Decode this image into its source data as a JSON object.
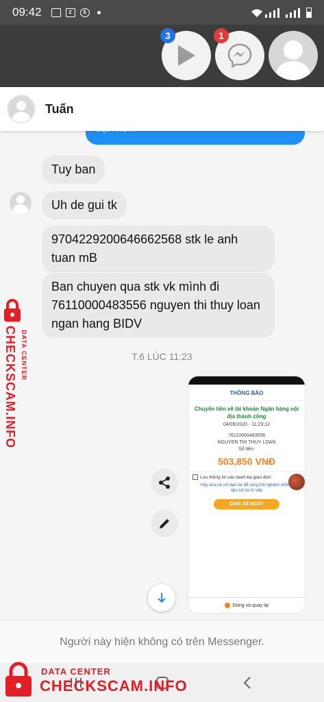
{
  "status_bar": {
    "time": "09:42",
    "icons": [
      "image-icon",
      "zalo-icon",
      "sync-icon",
      "wifi-icon",
      "signal-icon",
      "signal-icon",
      "battery-icon"
    ]
  },
  "chat_heads": [
    {
      "name": "video-player",
      "badge": "3"
    },
    {
      "name": "messenger",
      "badge": "1"
    },
    {
      "name": "contact-avatar",
      "badge": ""
    }
  ],
  "header": {
    "contact_name": "Tuấn"
  },
  "messages": {
    "sent_partial": "bạn liền.",
    "received": [
      "Tuy ban",
      "Uh de gui tk",
      "9704229200646662568 stk le anh tuan mB",
      "Ban chuyen qua stk vk mình đi 76110000483556 nguyen thi thuy loan  ngan hang BIDV"
    ]
  },
  "timestamp": "T.6 LÚC 11:23",
  "receipt": {
    "title": "THÔNG BÁO",
    "headline": "Chuyển tiền về tài khoản Ngân hàng nội địa thành công",
    "datetime": "04/09/2020 - 11:23:12",
    "account_number": "76110000483556",
    "account_name": "NGUYEN THI THUY LOAN",
    "amount_label": "Số tiền:",
    "amount": "503,850 VNĐ",
    "save_checkbox": "Lưu thông tin vào danh bạ giao dịch",
    "promo": "Hãy chia sẻ với bạn bè để cùng trải nghiệm những tiện ích từ Ví Việt",
    "share_button": "CHIA SẺ NGAY",
    "close_button": "Đóng và quay lại"
  },
  "footer_note": "Người này hiện không có trên Messenger.",
  "watermark": {
    "brand": "CHECKSCAM.INFO",
    "subtitle": "DATA CENTER",
    "color": "#e21f26"
  },
  "colors": {
    "sent_bubble": "#1e90f5",
    "received_bubble": "#e9e9e9",
    "badge_blue": "#1e73e8",
    "badge_red": "#e53935",
    "receipt_amount": "#f58220"
  }
}
